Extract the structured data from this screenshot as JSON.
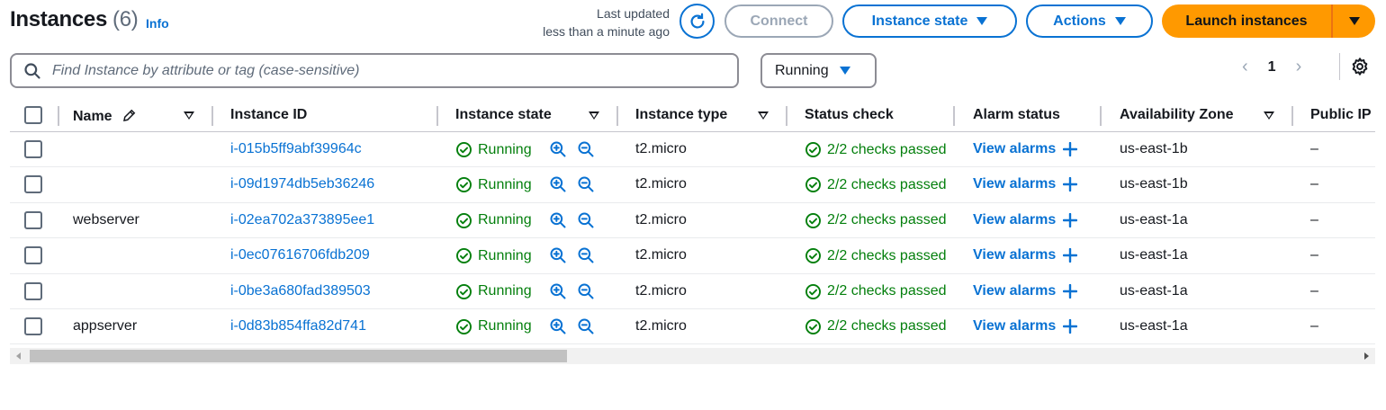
{
  "header": {
    "title": "Instances",
    "count": "(6)",
    "info_label": "Info",
    "last_updated_label": "Last updated",
    "last_updated_value": "less than a minute ago"
  },
  "toolbar": {
    "connect_label": "Connect",
    "instance_state_label": "Instance state",
    "actions_label": "Actions",
    "launch_label": "Launch instances"
  },
  "search": {
    "placeholder": "Find Instance by attribute or tag (case-sensitive)"
  },
  "filter": {
    "selected": "Running"
  },
  "pagination": {
    "current_page": "1"
  },
  "table": {
    "columns": [
      "Name",
      "Instance ID",
      "Instance state",
      "Instance type",
      "Status check",
      "Alarm status",
      "Availability Zone",
      "Public IP"
    ],
    "rows": [
      {
        "name": "",
        "id": "i-015b5ff9abf39964c",
        "state": "Running",
        "type": "t2.micro",
        "status": "2/2 checks passed",
        "alarm": "View alarms",
        "az": "us-east-1b",
        "ip": "–"
      },
      {
        "name": "",
        "id": "i-09d1974db5eb36246",
        "state": "Running",
        "type": "t2.micro",
        "status": "2/2 checks passed",
        "alarm": "View alarms",
        "az": "us-east-1b",
        "ip": "–"
      },
      {
        "name": "webserver",
        "id": "i-02ea702a373895ee1",
        "state": "Running",
        "type": "t2.micro",
        "status": "2/2 checks passed",
        "alarm": "View alarms",
        "az": "us-east-1a",
        "ip": "–"
      },
      {
        "name": "",
        "id": "i-0ec07616706fdb209",
        "state": "Running",
        "type": "t2.micro",
        "status": "2/2 checks passed",
        "alarm": "View alarms",
        "az": "us-east-1a",
        "ip": "–"
      },
      {
        "name": "",
        "id": "i-0be3a680fad389503",
        "state": "Running",
        "type": "t2.micro",
        "status": "2/2 checks passed",
        "alarm": "View alarms",
        "az": "us-east-1a",
        "ip": "–"
      },
      {
        "name": "appserver",
        "id": "i-0d83b854ffa82d741",
        "state": "Running",
        "type": "t2.micro",
        "status": "2/2 checks passed",
        "alarm": "View alarms",
        "az": "us-east-1a",
        "ip": "–"
      }
    ]
  },
  "colors": {
    "link": "#0972d3",
    "success": "#037f0c",
    "primary": "#ff9900"
  }
}
